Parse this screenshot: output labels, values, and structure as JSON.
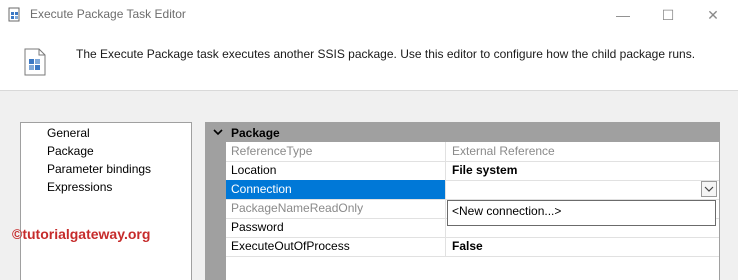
{
  "window": {
    "title": "Execute Package Task Editor",
    "minimize_glyph": "—",
    "maximize_glyph": "☐",
    "close_glyph": "✕"
  },
  "header": {
    "description": "The Execute Package task executes another SSIS package. Use this editor to configure how the child package runs.",
    "icon": "package-icon"
  },
  "nav": {
    "items": [
      {
        "label": "General"
      },
      {
        "label": "Package"
      },
      {
        "label": "Parameter bindings"
      },
      {
        "label": "Expressions"
      }
    ]
  },
  "grid": {
    "category": "Package",
    "rows": [
      {
        "name": "ReferenceType",
        "value": "External Reference",
        "readonly": true
      },
      {
        "name": "Location",
        "value": "File system",
        "readonly": false,
        "bold": true
      },
      {
        "name": "Connection",
        "value": "",
        "readonly": false,
        "selected": true
      },
      {
        "name": "PackageNameReadOnly",
        "value": "",
        "readonly": true
      },
      {
        "name": "Password",
        "value": "",
        "readonly": false
      },
      {
        "name": "ExecuteOutOfProcess",
        "value": "False",
        "readonly": false,
        "bold": true
      }
    ]
  },
  "dropdown": {
    "options": [
      "<New connection...>"
    ]
  },
  "watermark": "©tutorialgateway.org",
  "colors": {
    "selection": "#0078d7",
    "category_bg": "#a0a0a0",
    "watermark": "#c62b2b"
  }
}
